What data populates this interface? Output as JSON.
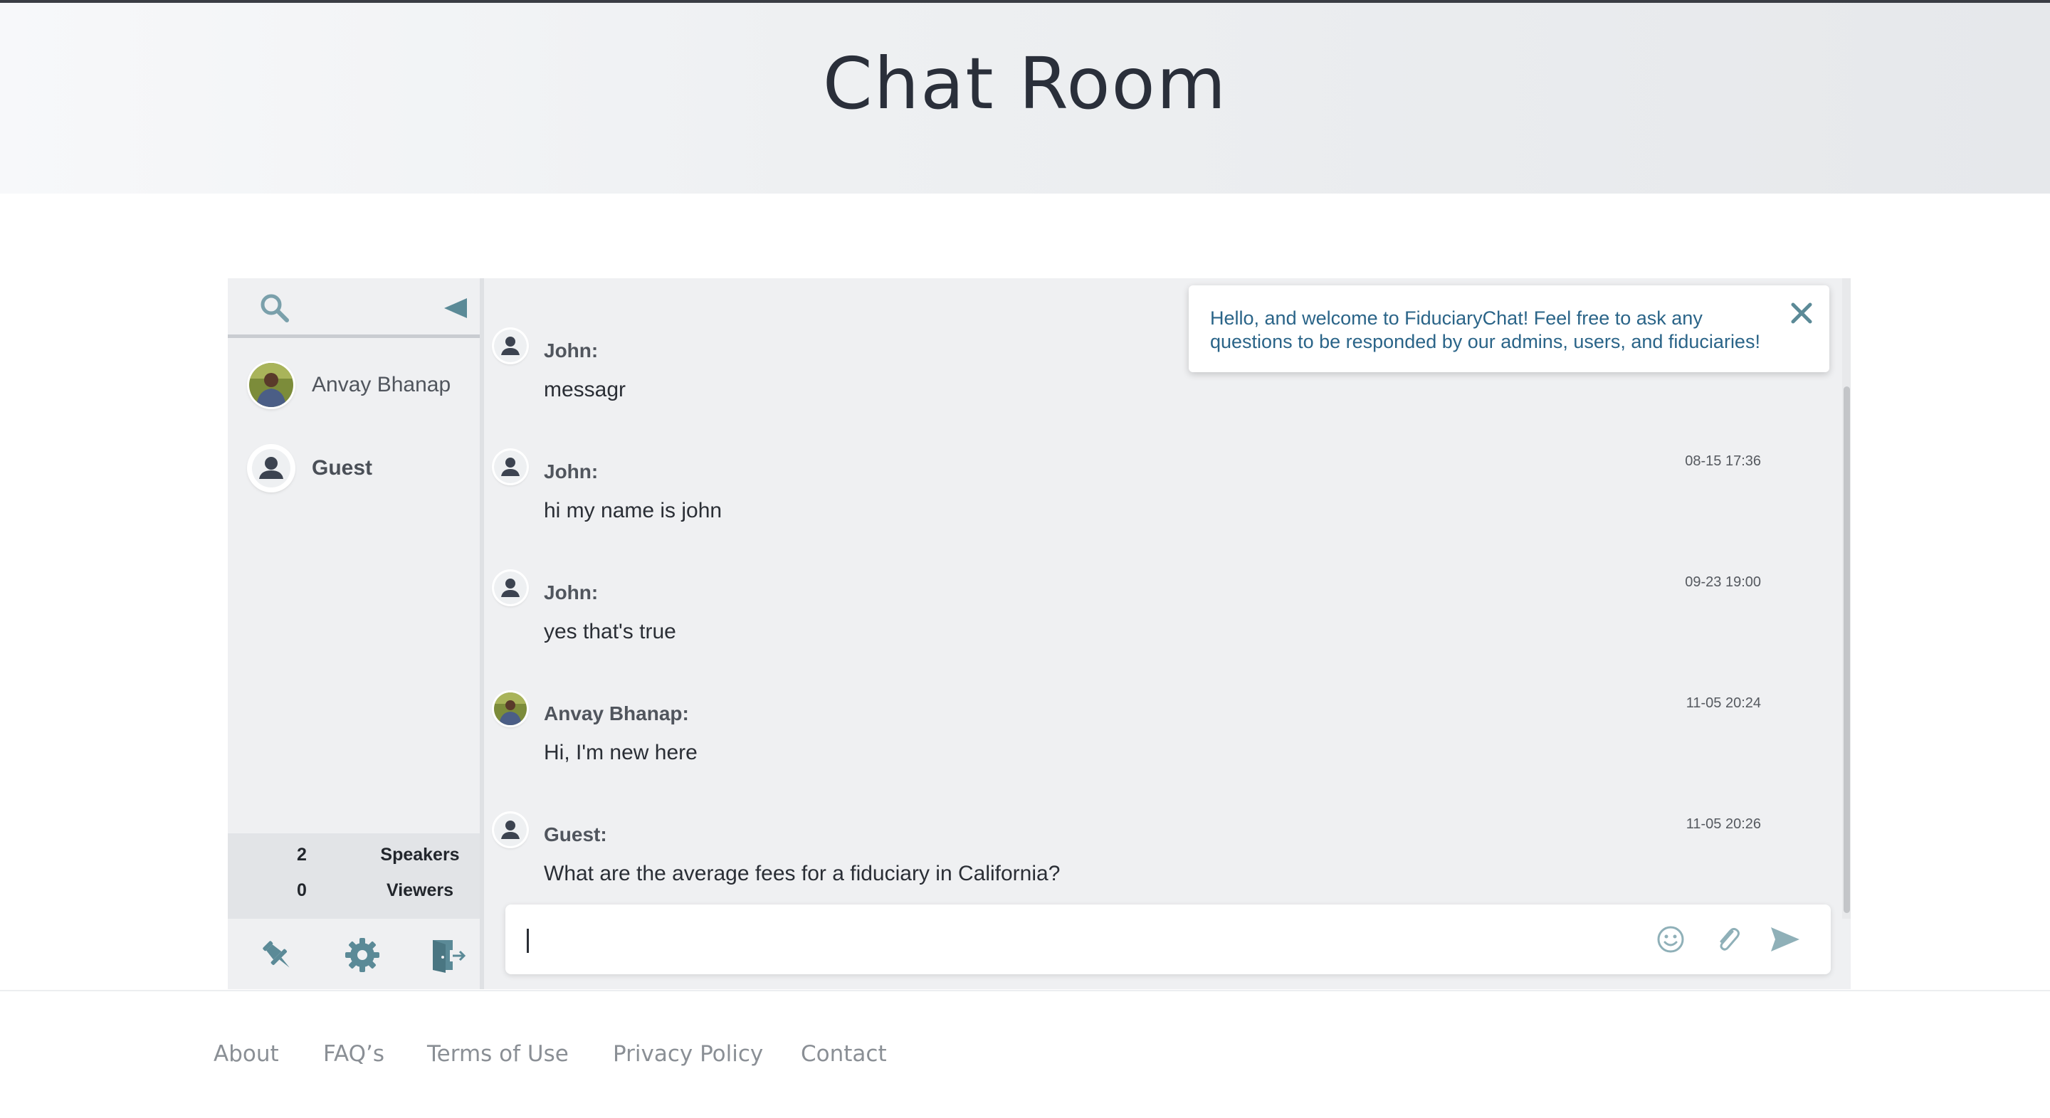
{
  "header": {
    "title": "Chat Room"
  },
  "sidebar": {
    "users": [
      {
        "name": "Anvay Bhanap",
        "avatar": "photo"
      },
      {
        "name": "Guest",
        "avatar": "default-person"
      }
    ],
    "stats": [
      {
        "count": "2",
        "label": "Speakers"
      },
      {
        "count": "0",
        "label": "Viewers"
      }
    ]
  },
  "toast": {
    "text": "Hello, and welcome to FiduciaryChat! Feel free to ask any questions to be responded by our admins, users, and fiduciaries!"
  },
  "messages": [
    {
      "author": "John:",
      "text": "messagr",
      "time": "",
      "avatar": "default-person"
    },
    {
      "author": "John:",
      "text": "hi my name is john",
      "time": "08-15 17:36",
      "avatar": "default-person"
    },
    {
      "author": "John:",
      "text": "yes that's true",
      "time": "09-23 19:00",
      "avatar": "default-person"
    },
    {
      "author": "Anvay Bhanap:",
      "text": "Hi, I'm new here",
      "time": "11-05 20:24",
      "avatar": "photo"
    },
    {
      "author": "Guest:",
      "text": "What are the average fees for a fiduciary in California?",
      "time": "11-05 20:26",
      "avatar": "default-person"
    }
  ],
  "input": {
    "value": "",
    "placeholder": ""
  },
  "footer": {
    "links": [
      "About",
      "FAQ’s",
      "Terms of Use",
      "Privacy Policy",
      "Contact"
    ]
  },
  "colors": {
    "accent": "#5b8a97",
    "toast_text": "#2a6488",
    "panel_bg": "#eff0f2",
    "title": "#2a2f3a"
  }
}
